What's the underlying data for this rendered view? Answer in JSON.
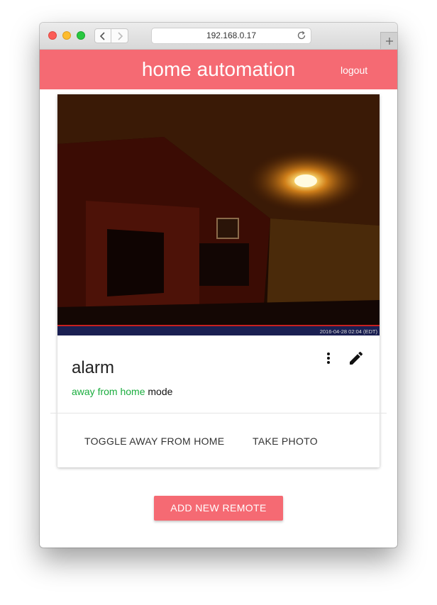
{
  "browser": {
    "url": "192.168.0.17",
    "icons": [
      "back-icon",
      "forward-icon",
      "reload-icon",
      "plus-icon"
    ]
  },
  "header": {
    "title": "home automation",
    "logout_label": "logout"
  },
  "card": {
    "image_timestamp": "2016-04-28 02:04 (EDT)",
    "title": "alarm",
    "status_highlight": "away from home",
    "status_suffix": "mode",
    "actions": {
      "toggle_label": "TOGGLE AWAY FROM HOME",
      "photo_label": "TAKE PHOTO"
    },
    "icons": [
      "more-vert-icon",
      "edit-icon"
    ]
  },
  "footer": {
    "add_label": "ADD NEW REMOTE"
  },
  "colors": {
    "brand": "#f56a73",
    "status_green": "#1aad3e"
  }
}
